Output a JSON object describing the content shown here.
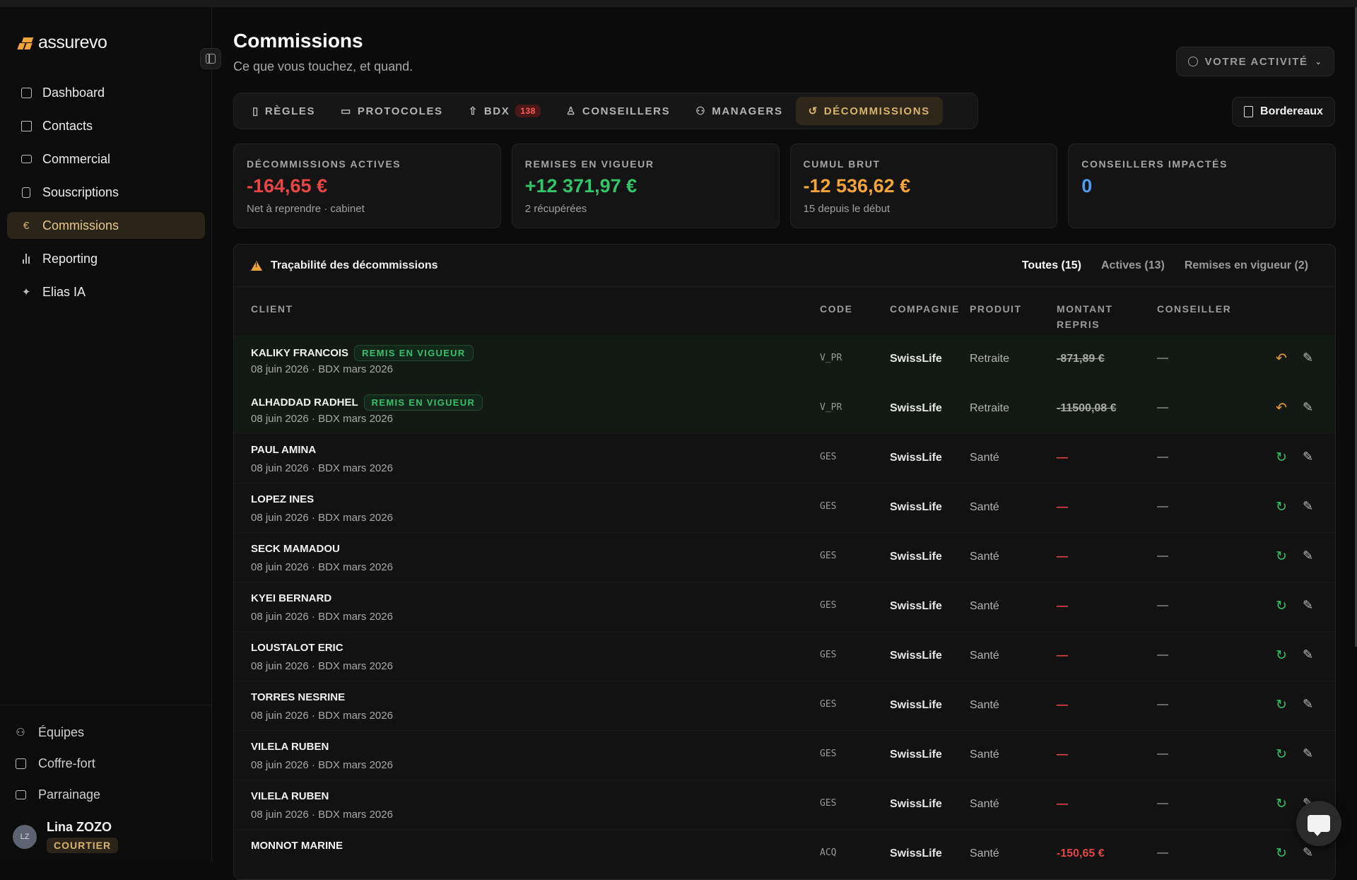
{
  "app": {
    "name": "assurevo"
  },
  "sidebar": {
    "items": [
      {
        "label": "Dashboard",
        "icon": "dashboard-icon"
      },
      {
        "label": "Contacts",
        "icon": "contacts-icon"
      },
      {
        "label": "Commercial",
        "icon": "briefcase-icon"
      },
      {
        "label": "Souscriptions",
        "icon": "file-plus-icon"
      },
      {
        "label": "Commissions",
        "icon": "euro-icon",
        "active": true
      },
      {
        "label": "Reporting",
        "icon": "bar-chart-icon"
      },
      {
        "label": "Elias IA",
        "icon": "sparkles-icon"
      }
    ],
    "bottom": [
      {
        "label": "Équipes",
        "icon": "users-icon"
      },
      {
        "label": "Coffre-fort",
        "icon": "vault-icon"
      },
      {
        "label": "Parrainage",
        "icon": "gift-icon"
      }
    ],
    "user": {
      "initials": "LZ",
      "name": "Lina ZOZO",
      "role": "COURTIER"
    }
  },
  "header": {
    "title": "Commissions",
    "subtitle": "Ce que vous touchez, et quand.",
    "activity": "VOTRE ACTIVITÉ",
    "bordereaux": "Bordereaux"
  },
  "tabs": [
    {
      "label": "RÈGLES",
      "icon": "book-icon"
    },
    {
      "label": "PROTOCOLES",
      "icon": "folder-icon"
    },
    {
      "label": "BDX",
      "icon": "upload-icon",
      "badge": "138"
    },
    {
      "label": "CONSEILLERS",
      "icon": "user-icon"
    },
    {
      "label": "MANAGERS",
      "icon": "users-icon"
    },
    {
      "label": "DÉCOMMISSIONS",
      "icon": "rotate-icon",
      "active": true
    }
  ],
  "kpis": [
    {
      "label": "DÉCOMMISSIONS ACTIVES",
      "value": "-164,65 €",
      "sub": "Net à reprendre · cabinet",
      "color": "#e84545"
    },
    {
      "label": "REMISES EN VIGUEUR",
      "value": "+12 371,97 €",
      "sub": "2 récupérées",
      "color": "#34c46a"
    },
    {
      "label": "CUMUL BRUT",
      "value": "-12 536,62 €",
      "sub": "15 depuis le début",
      "color": "#f2a33a"
    },
    {
      "label": "CONSEILLERS IMPACTÉS",
      "value": "0",
      "sub": "",
      "color": "#4f9bf2"
    }
  ],
  "panel": {
    "title": "Traçabilité des décommissions",
    "filters": [
      "Toutes (15)",
      "Actives (13)",
      "Remises en vigueur (2)"
    ],
    "columns": {
      "client": "CLIENT",
      "code": "CODE",
      "compagnie": "COMPAGNIE",
      "produit": "PRODUIT",
      "montant_l1": "MONTANT",
      "montant_l2": "REPRIS",
      "conseiller": "CONSEILLER"
    },
    "rows": [
      {
        "name": "KALIKY FRANCOIS",
        "status": "REMIS EN VIGUEUR",
        "date": "08 juin 2026 · BDX mars 2026",
        "code": "V_PR",
        "company": "SwissLife",
        "product": "Retraite",
        "amount": "-871,89 €",
        "amount_style": "strike",
        "advisor": "—",
        "action": "undo"
      },
      {
        "name": "ALHADDAD RADHEL",
        "status": "REMIS EN VIGUEUR",
        "date": "08 juin 2026 · BDX mars 2026",
        "code": "V_PR",
        "company": "SwissLife",
        "product": "Retraite",
        "amount": "-11500,08 €",
        "amount_style": "strike",
        "advisor": "—",
        "action": "undo"
      },
      {
        "name": "PAUL AMINA",
        "status": "",
        "date": "08 juin 2026 · BDX mars 2026",
        "code": "GES",
        "company": "SwissLife",
        "product": "Santé",
        "amount": "—",
        "amount_style": "dash",
        "advisor": "—",
        "action": "redo"
      },
      {
        "name": "LOPEZ INES",
        "status": "",
        "date": "08 juin 2026 · BDX mars 2026",
        "code": "GES",
        "company": "SwissLife",
        "product": "Santé",
        "amount": "—",
        "amount_style": "dash",
        "advisor": "—",
        "action": "redo"
      },
      {
        "name": "SECK MAMADOU",
        "status": "",
        "date": "08 juin 2026 · BDX mars 2026",
        "code": "GES",
        "company": "SwissLife",
        "product": "Santé",
        "amount": "—",
        "amount_style": "dash",
        "advisor": "—",
        "action": "redo"
      },
      {
        "name": "KYEI BERNARD",
        "status": "",
        "date": "08 juin 2026 · BDX mars 2026",
        "code": "GES",
        "company": "SwissLife",
        "product": "Santé",
        "amount": "—",
        "amount_style": "dash",
        "advisor": "—",
        "action": "redo"
      },
      {
        "name": "LOUSTALOT ERIC",
        "status": "",
        "date": "08 juin 2026 · BDX mars 2026",
        "code": "GES",
        "company": "SwissLife",
        "product": "Santé",
        "amount": "—",
        "amount_style": "dash",
        "advisor": "—",
        "action": "redo"
      },
      {
        "name": "TORRES NESRINE",
        "status": "",
        "date": "08 juin 2026 · BDX mars 2026",
        "code": "GES",
        "company": "SwissLife",
        "product": "Santé",
        "amount": "—",
        "amount_style": "dash",
        "advisor": "—",
        "action": "redo"
      },
      {
        "name": "VILELA RUBEN",
        "status": "",
        "date": "08 juin 2026 · BDX mars 2026",
        "code": "GES",
        "company": "SwissLife",
        "product": "Santé",
        "amount": "—",
        "amount_style": "dash",
        "advisor": "—",
        "action": "redo"
      },
      {
        "name": "VILELA RUBEN",
        "status": "",
        "date": "08 juin 2026 · BDX mars 2026",
        "code": "GES",
        "company": "SwissLife",
        "product": "Santé",
        "amount": "—",
        "amount_style": "dash",
        "advisor": "—",
        "action": "redo"
      },
      {
        "name": "MONNOT MARINE",
        "status": "",
        "date": "",
        "code": "ACQ",
        "company": "SwissLife",
        "product": "Santé",
        "amount": "-150,65 €",
        "amount_style": "neg",
        "advisor": "—",
        "action": "redo"
      }
    ]
  }
}
